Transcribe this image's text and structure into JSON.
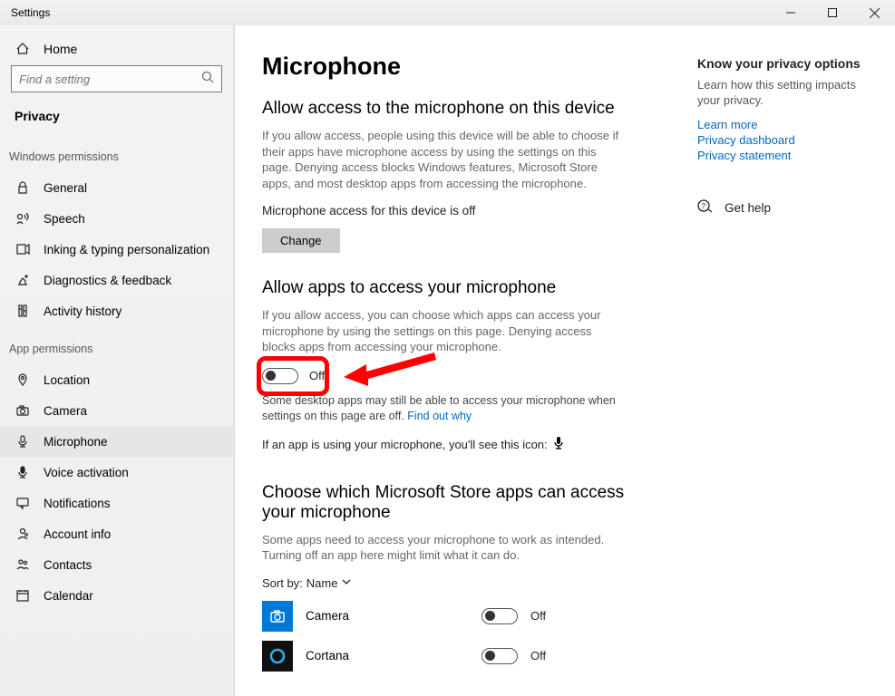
{
  "window": {
    "title": "Settings"
  },
  "sidebar": {
    "home": "Home",
    "search_placeholder": "Find a setting",
    "category_title": "Privacy",
    "section_win": "Windows permissions",
    "section_app": "App permissions",
    "win_items": [
      {
        "label": "General",
        "icon": "lock"
      },
      {
        "label": "Speech",
        "icon": "speech"
      },
      {
        "label": "Inking & typing personalization",
        "icon": "ink"
      },
      {
        "label": "Diagnostics & feedback",
        "icon": "diag"
      },
      {
        "label": "Activity history",
        "icon": "history"
      }
    ],
    "app_items": [
      {
        "label": "Location",
        "icon": "location"
      },
      {
        "label": "Camera",
        "icon": "camera"
      },
      {
        "label": "Microphone",
        "icon": "mic",
        "selected": true
      },
      {
        "label": "Voice activation",
        "icon": "voice"
      },
      {
        "label": "Notifications",
        "icon": "notif"
      },
      {
        "label": "Account info",
        "icon": "acct"
      },
      {
        "label": "Contacts",
        "icon": "contacts"
      },
      {
        "label": "Calendar",
        "icon": "calendar"
      }
    ]
  },
  "page": {
    "title": "Microphone",
    "s1_head": "Allow access to the microphone on this device",
    "s1_desc": "If you allow access, people using this device will be able to choose if their apps have microphone access by using the settings on this page. Denying access blocks Windows features, Microsoft Store apps, and most desktop apps from accessing the microphone.",
    "s1_status": "Microphone access for this device is off",
    "change": "Change",
    "s2_head": "Allow apps to access your microphone",
    "s2_desc": "If you allow access, you can choose which apps can access your microphone by using the settings on this page. Denying access blocks apps from accessing your microphone.",
    "toggle_off": "Off",
    "s2_hint1": "Some desktop apps may still be able to access your microphone when settings on this page are off. ",
    "s2_link": "Find out why",
    "s2_icon_text": "If an app is using your microphone, you'll see this icon:",
    "s3_head": "Choose which Microsoft Store apps can access your microphone",
    "s3_desc": "Some apps need to access your microphone to work as intended. Turning off an app here might limit what it can do.",
    "sort_label": "Sort by:",
    "sort_value": "Name",
    "apps": [
      {
        "name": "Camera",
        "state": "Off",
        "color": "#0078d7",
        "glyph": "camera"
      },
      {
        "name": "Cortana",
        "state": "Off",
        "color": "#111",
        "glyph": "cortana"
      }
    ]
  },
  "right": {
    "head": "Know your privacy options",
    "desc": "Learn how this setting impacts your privacy.",
    "links": [
      "Learn more",
      "Privacy dashboard",
      "Privacy statement"
    ],
    "help": "Get help"
  }
}
